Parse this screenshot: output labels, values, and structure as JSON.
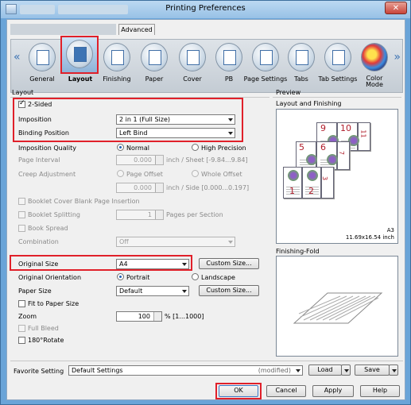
{
  "window": {
    "title": "Printing Preferences",
    "close_glyph": "✕"
  },
  "tabs": {
    "advanced": "Advanced"
  },
  "iconbar": {
    "items": [
      {
        "label": "General"
      },
      {
        "label": "Layout"
      },
      {
        "label": "Finishing"
      },
      {
        "label": "Paper"
      },
      {
        "label": "Cover"
      },
      {
        "label": "PB"
      },
      {
        "label": "Page Settings"
      },
      {
        "label": "Tabs"
      },
      {
        "label": "Tab Settings"
      },
      {
        "label": "Color Mode"
      }
    ],
    "selected": "Layout"
  },
  "layout": {
    "group_title": "Layout",
    "two_sided": {
      "label": "2-Sided",
      "checked": true
    },
    "imposition": {
      "label": "Imposition",
      "value": "2 in 1 (Full Size)"
    },
    "binding_position": {
      "label": "Binding Position",
      "value": "Left Bind"
    },
    "imposition_quality": {
      "label": "Imposition Quality",
      "normal": "Normal",
      "high": "High Precision"
    },
    "page_interval": {
      "label": "Page Interval",
      "value": "0.000",
      "unit": "inch / Sheet [-9.84...9.84]"
    },
    "creep_adjustment": {
      "label": "Creep Adjustment",
      "page_offset": "Page Offset",
      "whole_offset": "Whole Offset",
      "value": "0.000",
      "unit": "inch / Side [0.000...0.197]"
    },
    "booklet_cover_blank": "Booklet Cover Blank Page Insertion",
    "booklet_splitting": {
      "label": "Booklet Splitting",
      "value": "1",
      "unit": "Pages per Section"
    },
    "book_spread": "Book Spread",
    "combination": {
      "label": "Combination",
      "value": "Off"
    },
    "original_size": {
      "label": "Original Size",
      "value": "A4",
      "button": "Custom Size..."
    },
    "original_orientation": {
      "label": "Original Orientation",
      "portrait": "Portrait",
      "landscape": "Landscape"
    },
    "paper_size": {
      "label": "Paper Size",
      "value": "Default",
      "button": "Custom Size..."
    },
    "fit_to_paper": "Fit to Paper Size",
    "zoom": {
      "label": "Zoom",
      "value": "100",
      "unit": "% [1...1000]"
    },
    "full_bleed": "Full Bleed",
    "rotate180": "180°Rotate"
  },
  "preview": {
    "group_title": "Preview",
    "layout_finishing": "Layout and Finishing",
    "paper_name": "A3",
    "paper_dims": "11.69x16.54 inch",
    "finishing_fold": "Finishing-Fold",
    "page_numbers": [
      "9",
      "10",
      "11",
      "5",
      "6",
      "7",
      "1",
      "2",
      "3"
    ]
  },
  "favorite": {
    "label": "Favorite Setting",
    "value": "Default Settings",
    "modified": "(modified)",
    "load": "Load",
    "save": "Save"
  },
  "footer": {
    "ok": "OK",
    "cancel": "Cancel",
    "apply": "Apply",
    "help": "Help"
  }
}
